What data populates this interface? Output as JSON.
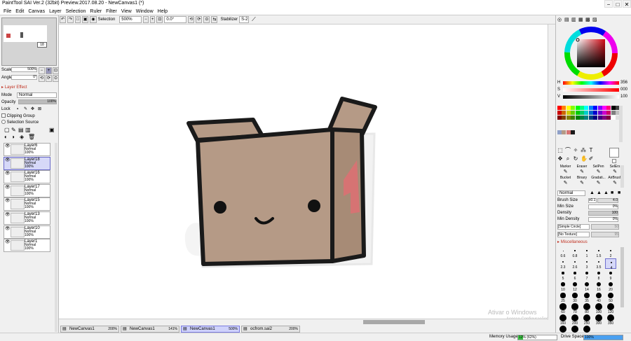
{
  "app": {
    "title": "PaintTool SAI Ver.2 (32bit) Preview.2017.08.20 - NewCanvas1 (*)"
  },
  "menu": [
    "File",
    "Edit",
    "Canvas",
    "Layer",
    "Selection",
    "Ruler",
    "Filter",
    "View",
    "Window",
    "Help"
  ],
  "toolbar": {
    "selection_label": "Selection",
    "zoom": "500%",
    "angle": "0.0°",
    "stabilizer_label": "Stabilizer",
    "stabilizer": "S-2"
  },
  "navigator": {
    "scale_label": "Scale",
    "scale": "500%",
    "angle_label": "Angle",
    "angle": "0°",
    "page": "18"
  },
  "layer_effect": {
    "title": "Layer Effect",
    "mode_label": "Mode",
    "mode": "Normal",
    "opacity_label": "Opacity",
    "opacity": "100%",
    "lock_label": "Lock",
    "clipping": "Clipping Group",
    "selection_source": "Selection Source"
  },
  "layers": [
    {
      "name": "Layer6",
      "mode": "Normal",
      "opacity": "100%",
      "selected": false
    },
    {
      "name": "Layer18",
      "mode": "Normal",
      "opacity": "100%",
      "selected": true
    },
    {
      "name": "Layer16",
      "mode": "Normal",
      "opacity": "100%",
      "selected": false
    },
    {
      "name": "Layer17",
      "mode": "Normal",
      "opacity": "100%",
      "selected": false
    },
    {
      "name": "Layer15",
      "mode": "Normal",
      "opacity": "100%",
      "selected": false
    },
    {
      "name": "Layer13",
      "mode": "Normal",
      "opacity": "100%",
      "selected": false
    },
    {
      "name": "Layer10",
      "mode": "Normal",
      "opacity": "100%",
      "selected": false
    },
    {
      "name": "Layer1",
      "mode": "Normal",
      "opacity": "100%",
      "selected": false
    }
  ],
  "tabs": [
    {
      "name": "NewCanvas1",
      "zoom": "200%",
      "active": false
    },
    {
      "name": "NewCanvas1",
      "zoom": "141%",
      "active": false
    },
    {
      "name": "NewCanvas1",
      "zoom": "500%",
      "active": true
    },
    {
      "name": "ocfrom.sai2",
      "zoom": "200%",
      "active": false
    }
  ],
  "color": {
    "h_label": "H",
    "h": "356",
    "s_label": "S",
    "s": "000",
    "v_label": "V",
    "v": "100",
    "main_color": "#d20a14"
  },
  "tools": {
    "names": [
      "Marker",
      "Eraser",
      "SelPen",
      "SelErs",
      "Bucket",
      "Binary",
      "Gradati...",
      "AirBrush"
    ],
    "blend_mode": "Normal",
    "brush_size_label": "Brush Size",
    "brush_size_mult": "x0.1",
    "brush_size": "4.0",
    "min_size_label": "Min Size",
    "min_size": "0%",
    "density_label": "Density",
    "density": "100",
    "min_density_label": "Min Density",
    "min_density": "0%",
    "shape": "[Simple Circle]",
    "texture": "[No Texture]",
    "shape_val": "50",
    "texture_val": "95",
    "misc": "Miscellaneous",
    "brush_sizes": [
      "0.6",
      "0.8",
      "1",
      "1.5",
      "2",
      "2.3",
      "2.6",
      "3",
      "3.5",
      "4",
      "5",
      "6",
      "7",
      "8",
      "9",
      "10",
      "12",
      "14",
      "16",
      "20",
      "25",
      "30",
      "35",
      "40",
      "50",
      "60",
      "70",
      "80",
      "100",
      "120",
      "160",
      "200",
      "250",
      "300",
      "350",
      "400",
      "450",
      "500"
    ]
  },
  "status": {
    "memory_label": "Memory Usage",
    "memory": "12% (62%)",
    "drive_label": "Drive Space",
    "drive": "100%",
    "watermark1": "Ativar o Windows",
    "watermark2": "Acesse Configurações"
  },
  "window_buttons": {
    "minimize": "−",
    "maximize": "□",
    "close": "✕"
  }
}
